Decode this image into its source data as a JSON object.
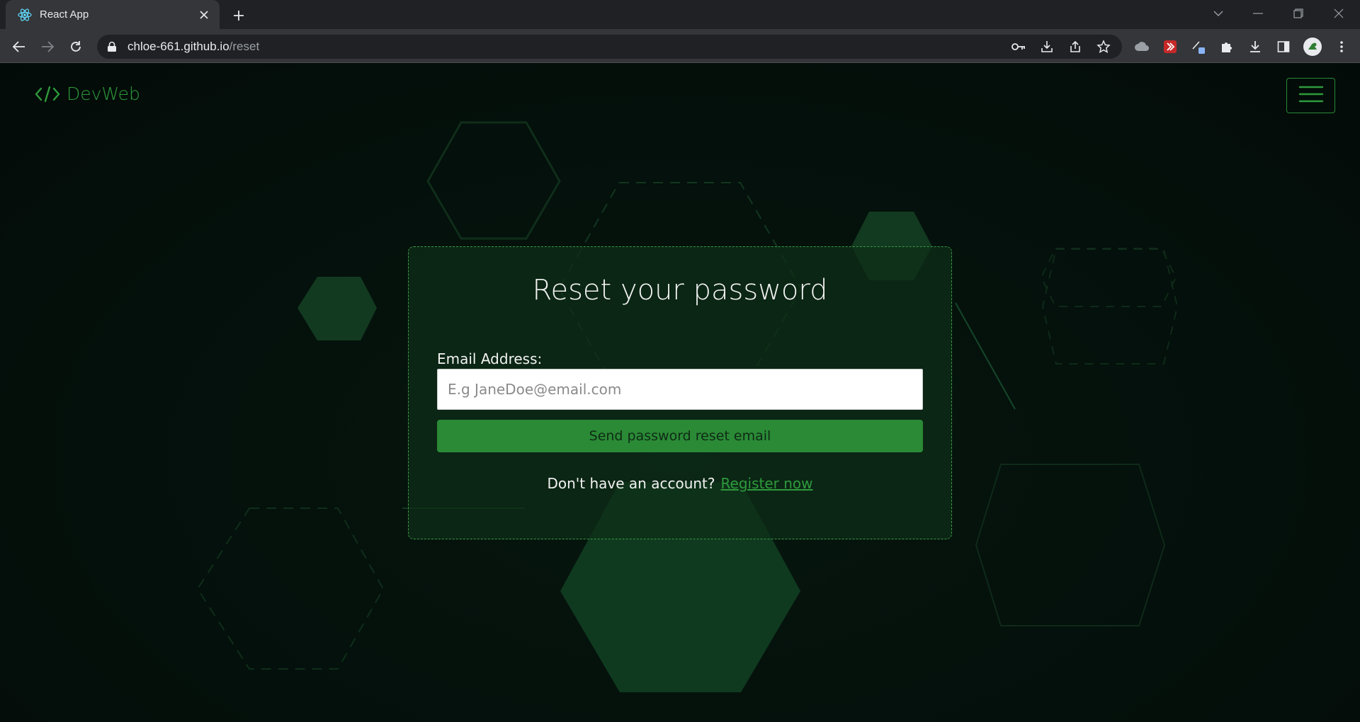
{
  "browser": {
    "tab_title": "React App",
    "url_host": "chloe-661.github.io",
    "url_path": "/reset",
    "icons": [
      "react-favicon",
      "close-icon",
      "plus-icon",
      "back-arrow-icon",
      "forward-arrow-icon",
      "reload-icon",
      "lock-icon",
      "key-icon",
      "install-icon",
      "share-icon",
      "star-icon",
      "extension-icon",
      "puzzle-icon",
      "download-icon",
      "side-panel-icon",
      "avatar",
      "kebab-menu-icon"
    ]
  },
  "header": {
    "brand_name": "DevWeb",
    "brand_icon": "code-brackets-icon",
    "menu_icon": "hamburger-menu-icon"
  },
  "reset_form": {
    "title": "Reset your password",
    "email_label": "Email Address:",
    "email_placeholder": "E.g JaneDoe@email.com",
    "email_value": "",
    "submit_label": "Send password reset email",
    "register_prompt": "Don't have an account?",
    "register_link": "Register now"
  },
  "colors": {
    "page_background": "#04100b",
    "accent_green": "#2e9a3c",
    "button_green": "#2a8a36",
    "card_fill": "#0e2e18"
  }
}
